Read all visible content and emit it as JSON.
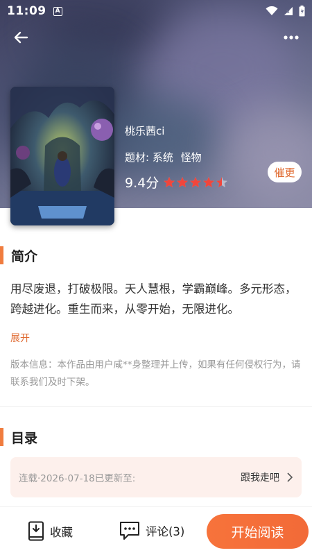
{
  "status_bar": {
    "time": "11:09",
    "notification_letter": "A"
  },
  "book": {
    "author": "桃乐茜ci",
    "genre_label": "题材:",
    "genre_tags": [
      "系统",
      "怪物"
    ],
    "score_text": "9.4分",
    "rating_stars": 4.5,
    "rating_max": 5,
    "urge_label": "催更"
  },
  "synopsis": {
    "title": "简介",
    "text": "用尽废退，打破极限。天人慧根，学霸巅峰。多元形态，跨越进化。重生而来，从零开始，无限进化。",
    "expand_label": "展开",
    "notice": "版本信息：本作品由用户咸**身整理并上传，如果有任何侵权行为，请联系我们及时下架。"
  },
  "toc": {
    "title": "目录",
    "status": "连载·2026-07-18已更新至:",
    "latest_chapter": "跟我走吧"
  },
  "bottom_bar": {
    "favorite_label": "收藏",
    "comment_label": "评论(3)",
    "read_label": "开始阅读"
  },
  "colors": {
    "accent": "#f07c3e",
    "accent_text": "#e06b32",
    "star": "#f0463c",
    "toc_bg": "#fdf0ec"
  },
  "icons": [
    "back-arrow-icon",
    "more-dots-icon",
    "star-icon",
    "chevron-right-icon",
    "bookmark-book-icon",
    "comment-bubble-icon",
    "wifi-icon",
    "signal-icon",
    "battery-icon"
  ]
}
